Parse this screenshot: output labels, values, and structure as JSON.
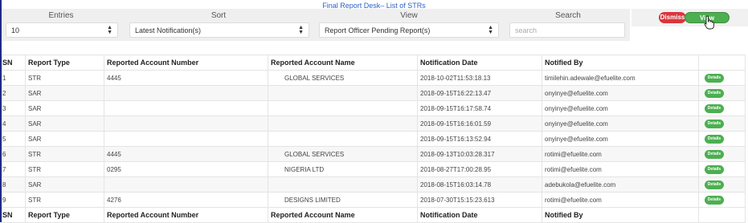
{
  "page": {
    "title": "Final Report Desk– List of STRs"
  },
  "controls": {
    "entries": {
      "label": "Entries",
      "value": "10"
    },
    "sort": {
      "label": "Sort",
      "value": "Latest Notification(s)"
    },
    "view": {
      "label": "View",
      "value": "Report Officer Pending Report(s)"
    },
    "search": {
      "label": "Search",
      "placeholder": "search"
    }
  },
  "actions": {
    "dismiss_label": "Dismiss",
    "view_label": "View Report(s)"
  },
  "table": {
    "headers": [
      "SN",
      "Report Type",
      "Reported Account Number",
      "Reported Account Name",
      "Notification Date",
      "Notified By",
      ""
    ],
    "details_label": "Details",
    "rows": [
      {
        "sn": "1",
        "type": "STR",
        "account_number": "4445",
        "account_name": "GLOBAL SERVICES",
        "date": "2018-10-02T11:53:18.13",
        "notified_by": "timilehin.adewale@efuelite.com"
      },
      {
        "sn": "2",
        "type": "SAR",
        "account_number": "",
        "account_name": "",
        "date": "2018-09-15T16:22:13.47",
        "notified_by": "onyinye@efuelite.com"
      },
      {
        "sn": "3",
        "type": "SAR",
        "account_number": "",
        "account_name": "",
        "date": "2018-09-15T16:17:58.74",
        "notified_by": "onyinye@efuelite.com"
      },
      {
        "sn": "4",
        "type": "SAR",
        "account_number": "",
        "account_name": "",
        "date": "2018-09-15T16:16:01.59",
        "notified_by": "onyinye@efuelite.com"
      },
      {
        "sn": "5",
        "type": "SAR",
        "account_number": "",
        "account_name": "",
        "date": "2018-09-15T16:13:52.94",
        "notified_by": "onyinye@efuelite.com"
      },
      {
        "sn": "6",
        "type": "STR",
        "account_number": "4445",
        "account_name": "GLOBAL SERVICES",
        "date": "2018-09-13T10:03:28.317",
        "notified_by": "rotimi@efuelite.com"
      },
      {
        "sn": "7",
        "type": "STR",
        "account_number": "0295",
        "account_name": "NIGERIA LTD",
        "date": "2018-08-27T17:00:28.95",
        "notified_by": "rotimi@efuelite.com"
      },
      {
        "sn": "8",
        "type": "SAR",
        "account_number": "",
        "account_name": "",
        "date": "2018-08-15T16:03:14.78",
        "notified_by": "adebukola@efuelite.com"
      },
      {
        "sn": "9",
        "type": "STR",
        "account_number": "4276",
        "account_name": "DESIGNS LIMITED",
        "date": "2018-07-30T15:15:23.613",
        "notified_by": "rotimi@efuelite.com"
      }
    ]
  }
}
